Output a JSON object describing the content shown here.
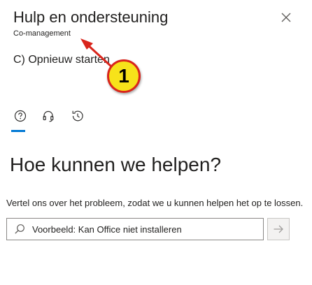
{
  "panel": {
    "title": "Hulp en ondersteuning",
    "subtitle": "Co-management",
    "close_icon": "close-icon"
  },
  "step": {
    "text": "C) Opnieuw starten"
  },
  "callout": {
    "number": "1",
    "badge_fill": "#f7e21a",
    "badge_border": "#d9251c",
    "arrow_color": "#d9251c"
  },
  "tabs": [
    {
      "icon": "help-question-icon",
      "selected": true
    },
    {
      "icon": "headset-icon",
      "selected": false
    },
    {
      "icon": "history-icon",
      "selected": false
    }
  ],
  "accent_color": "#0078d4",
  "main": {
    "heading": "Hoe kunnen we helpen?",
    "description": "Vertel ons over het probleem, zodat we u kunnen helpen het op te lossen."
  },
  "search": {
    "placeholder": "Voorbeeld: Kan Office niet installeren",
    "icon": "search-icon",
    "submit_icon": "arrow-right-icon"
  }
}
